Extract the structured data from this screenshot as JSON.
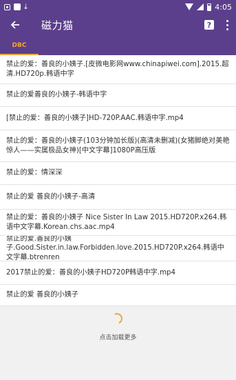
{
  "status_bar": {
    "time": "4:05"
  },
  "app_bar": {
    "title": "磁力猫"
  },
  "tabs": [
    {
      "label": "DBC"
    }
  ],
  "results": [
    {
      "title": "禁止的爱：善良的小姨子.[皮微电影网www.chinapiwei.com].2015.超清.HD720p.韩语中字"
    },
    {
      "title": "禁止的爱善良的小姨子-韩语中字"
    },
    {
      "title": "[禁止的爱：善良的小姨子]HD-720P.AAC.韩语中字.mp4"
    },
    {
      "title": "禁止的爱：善良的小姨子(103分钟加长版)(高清未删减)(女猪脚绝对美艳惊人——实属极品女神)[中文字幕]1080P高压版"
    },
    {
      "title": "禁止的爱：情深深"
    },
    {
      "title": "禁止的爱 善良的小姨子-高清"
    },
    {
      "title": "禁止的爱：善良的小姨子 Nice Sister In Law 2015.HD720P.x264.韩语中文字幕.Korean.chs.aac.mp4"
    },
    {
      "title": "禁止的爱.善良的小姨子.Good.Sister.in.law.Forbidden.love.2015.HD720P.x264.韩语中文字幕.btrenren"
    },
    {
      "title": "2017禁止的爱：善良的小姨子HD720P韩语中字.mp4"
    },
    {
      "title": "禁止的爱 善良的小姨子"
    }
  ],
  "load_more": {
    "label": "点击加载更多"
  },
  "colors": {
    "primary": "#5b3f8c",
    "accent": "#f1a533"
  },
  "icons": {
    "back": "arrow-left-icon",
    "help": "help-icon",
    "more": "more-vert-icon"
  }
}
